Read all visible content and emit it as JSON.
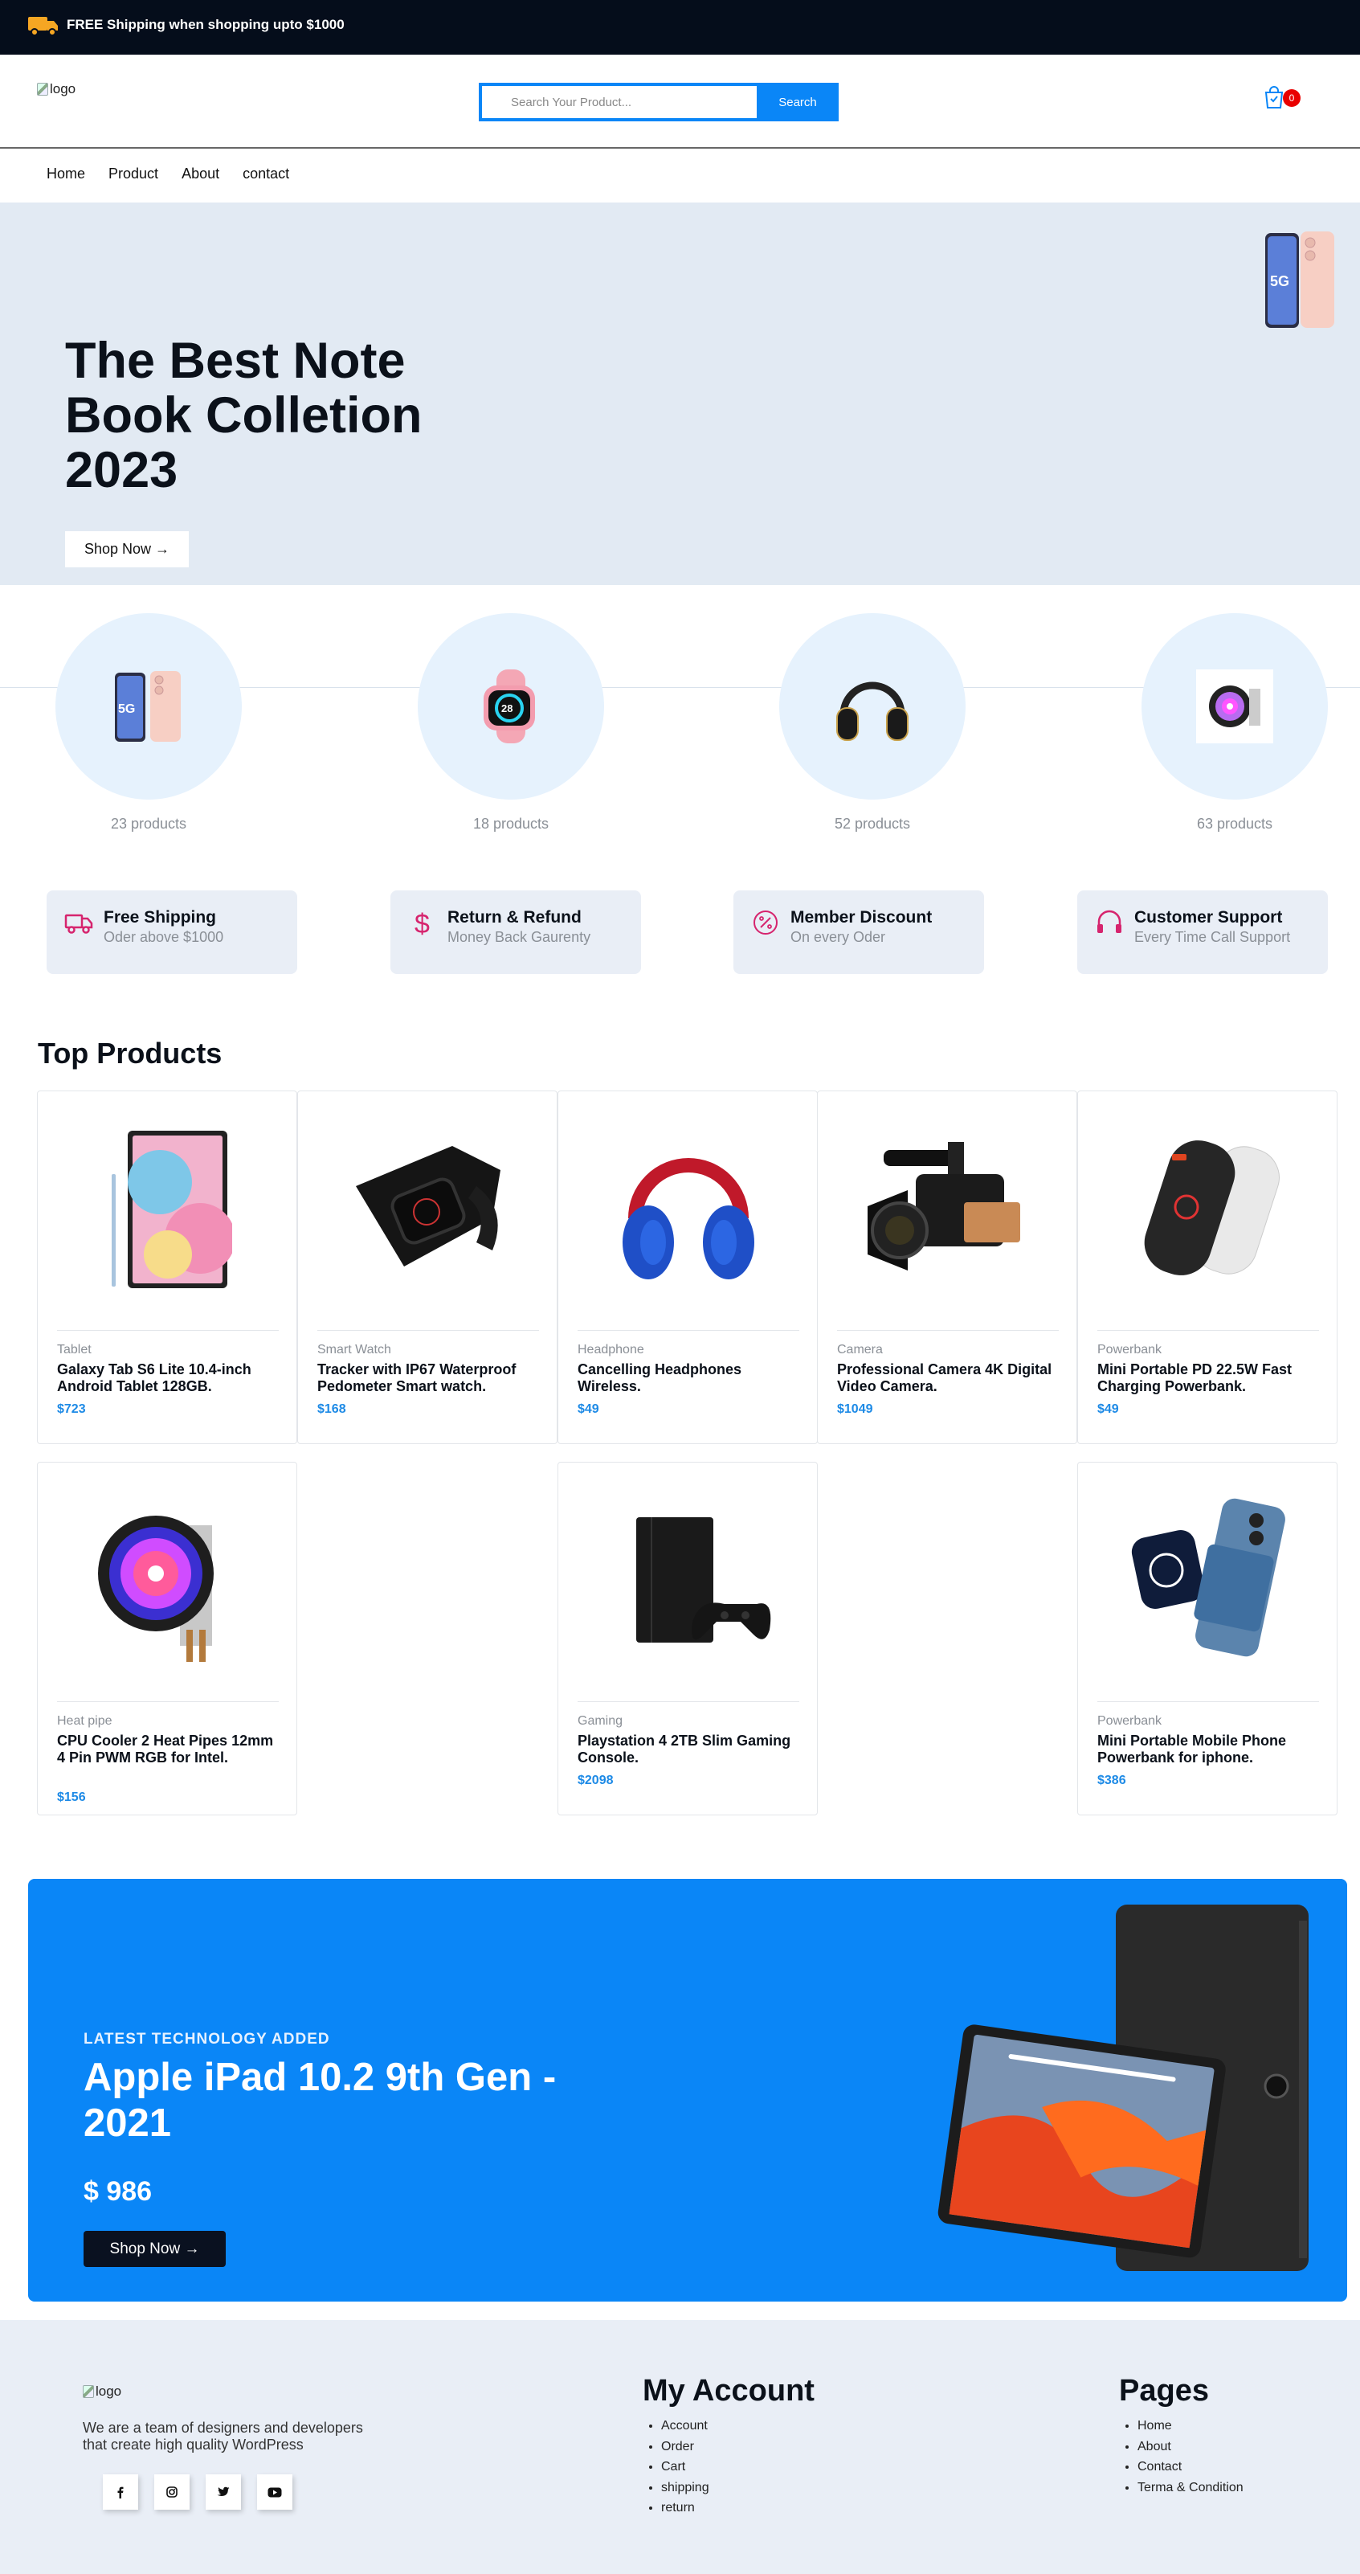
{
  "topbar": {
    "shipping_text": "FREE Shipping when shopping upto $1000",
    "truck_color": "#f5a623"
  },
  "header": {
    "logo_alt": "logo",
    "search": {
      "placeholder": "Search Your Product...",
      "button_label": "Search"
    },
    "cart_count": "0"
  },
  "nav": {
    "items": [
      "Home",
      "Product",
      "About",
      "contact"
    ]
  },
  "hero": {
    "title": "The Best Note Book Colletion 2023",
    "button_label": "Shop Now"
  },
  "categories": [
    {
      "icon": "phone-icon",
      "count": "23 products"
    },
    {
      "icon": "smartwatch-icon",
      "count": "18 products"
    },
    {
      "icon": "headphone-icon",
      "count": "52 products"
    },
    {
      "icon": "cooler-icon",
      "count": "63 products"
    }
  ],
  "features": [
    {
      "icon": "truck-icon",
      "title": "Free Shipping",
      "subtitle": "Oder above $1000"
    },
    {
      "icon": "dollar-icon",
      "title": "Return & Refund",
      "subtitle": "Money Back Gaurenty"
    },
    {
      "icon": "percent-icon",
      "title": "Member Discount",
      "subtitle": "On every Oder"
    },
    {
      "icon": "headset-icon",
      "title": "Customer Support",
      "subtitle": "Every Time Call Support"
    }
  ],
  "top_products": {
    "title": "Top Products",
    "items": [
      {
        "category": "Tablet",
        "name": "Galaxy Tab S6 Lite 10.4-inch Android Tablet 128GB.",
        "price": "$723"
      },
      {
        "category": "Smart Watch",
        "name": "Tracker with IP67 Waterproof Pedometer Smart watch.",
        "price": "$168"
      },
      {
        "category": "Headphone",
        "name": "Cancelling Headphones Wireless.",
        "price": "$49"
      },
      {
        "category": "Camera",
        "name": "Professional Camera 4K Digital Video Camera.",
        "price": "$1049"
      },
      {
        "category": "Powerbank",
        "name": "Mini Portable PD 22.5W Fast Charging Powerbank.",
        "price": "$49"
      },
      {
        "category": "Heat pipe",
        "name": "CPU Cooler 2 Heat Pipes 12mm 4 Pin PWM RGB for Intel.",
        "price": "$156"
      },
      {
        "category": "Gaming",
        "name": "Playstation 4 2TB Slim Gaming Console.",
        "price": "$2098"
      },
      {
        "category": "Powerbank",
        "name": "Mini Portable Mobile Phone Powerbank for iphone.",
        "price": "$386"
      }
    ]
  },
  "promo": {
    "kicker": "LATEST TECHNOLOGY ADDED",
    "title": "Apple iPad 10.2 9th Gen - 2021",
    "price": "$ 986",
    "button_label": "Shop Now"
  },
  "footer": {
    "logo_alt": "logo",
    "about": "We are a team of designers and developers that create high quality WordPress",
    "socials": [
      "facebook-icon",
      "instagram-icon",
      "twitter-icon",
      "youtube-icon"
    ],
    "account": {
      "title": "My Account",
      "links": [
        "Account",
        "Order",
        "Cart",
        "shipping",
        "return"
      ]
    },
    "pages": {
      "title": "Pages",
      "links": [
        "Home",
        "About",
        "Contact",
        "Terma & Condition"
      ]
    }
  },
  "colors": {
    "accent": "#0a86f7",
    "dark": "#050d1b",
    "hero_bg": "#e2eaf3",
    "feature_icon": "#d6246e"
  }
}
